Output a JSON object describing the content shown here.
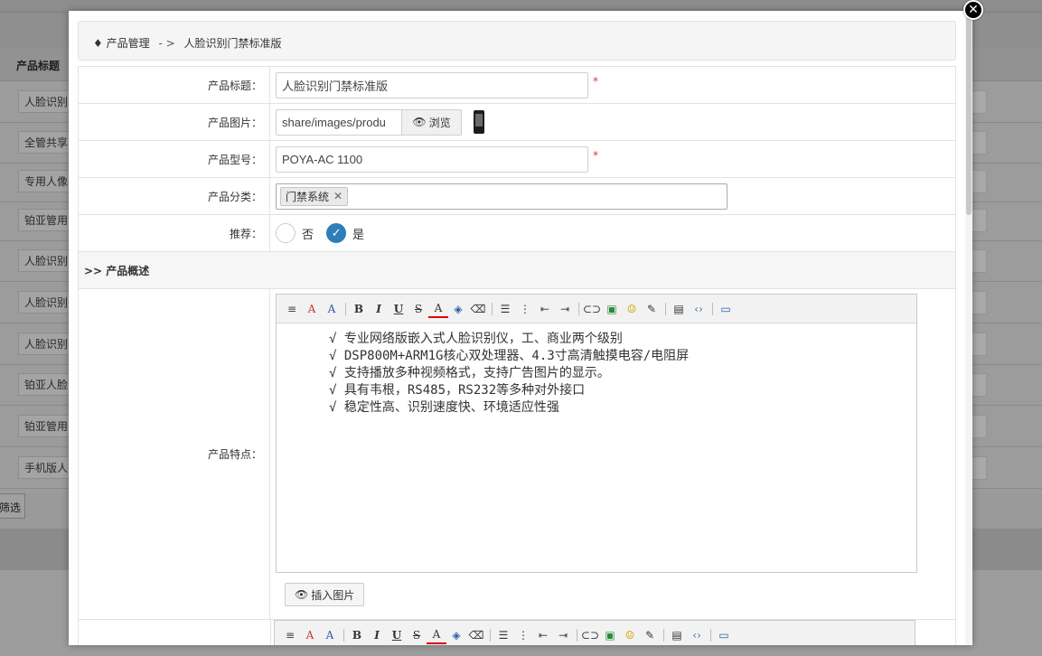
{
  "background": {
    "table_header": "产品标题",
    "rows": [
      "人脸识别",
      "全管共享",
      "专用人像",
      "铂亚管用",
      "人脸识别",
      "人脸识别",
      "人脸识别",
      "铂亚人脸",
      "铂亚管用",
      "手机版人"
    ],
    "filter_button": "筛选"
  },
  "breadcrumb": {
    "root": "产品管理",
    "separator": "- >",
    "current": "人脸识别门禁标准版"
  },
  "form": {
    "title_label": "产品标题：",
    "title_value": "人脸识别门禁标准版",
    "required_mark": "*",
    "image_label": "产品图片：",
    "image_path": "share/images/produ",
    "browse_label": "浏览",
    "model_label": "产品型号：",
    "model_value": "POYA-AC 1100",
    "category_label": "产品分类：",
    "category_tag": "门禁系统",
    "tag_remove": "✕",
    "recommend_label": "推荐：",
    "option_no": "否",
    "option_yes": "是",
    "section_overview": ">> 产品概述",
    "features_label": "产品特点：",
    "insert_image_label": "插入图片"
  },
  "editor": {
    "lines": [
      "√ 专业网络版嵌入式人脸识别仪，工、商业两个级别",
      "√ DSP800M+ARM1G核心双处理器、4.3寸高清触摸电容/电阻屏",
      "√ 支持播放多种视频格式，支持广告图片的显示。",
      "√ 具有韦根，RS485，RS232等多种对外接口",
      "√ 稳定性高、识别速度快、环境适应性强"
    ]
  },
  "colors": {
    "accent": "#2e7fb8",
    "required": "#d33333"
  }
}
